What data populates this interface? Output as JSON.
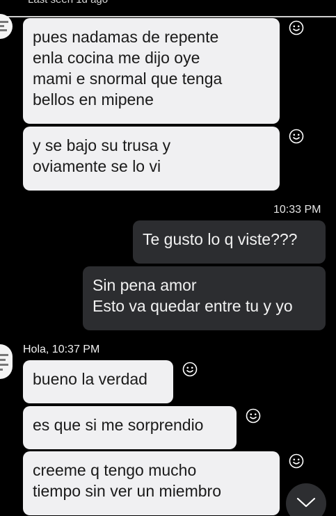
{
  "header": {
    "status": "Last seen 1d ago"
  },
  "icons": {
    "reaction": "smiley-icon",
    "scroll": "chevron-down-icon"
  },
  "messages": [
    {
      "dir": "in",
      "text": "pues nadamas de repente\nenla cocina me dijo oye\nmami e snormal que tenga\nbellos en mipene"
    },
    {
      "dir": "in",
      "text": "y se bajo su trusa y\noviamente se lo vi"
    },
    {
      "dir": "out",
      "time": "10:33 PM"
    },
    {
      "dir": "out",
      "text": "Te gusto lo q viste???"
    },
    {
      "dir": "out",
      "text": "Sin pena amor\nEsto va quedar entre tu y yo"
    },
    {
      "dir": "in",
      "sender_time": "Hola, 10:37 PM"
    },
    {
      "dir": "in",
      "text": "bueno la verdad"
    },
    {
      "dir": "in",
      "text": "es que si me sorprendio"
    },
    {
      "dir": "in",
      "text": "creeme  q tengo mucho\ntiempo sin ver  un miembro"
    }
  ],
  "colors": {
    "incoming_bubble": "#f0f0f2",
    "outgoing_bubble": "#2c2d30",
    "background": "#000000"
  }
}
